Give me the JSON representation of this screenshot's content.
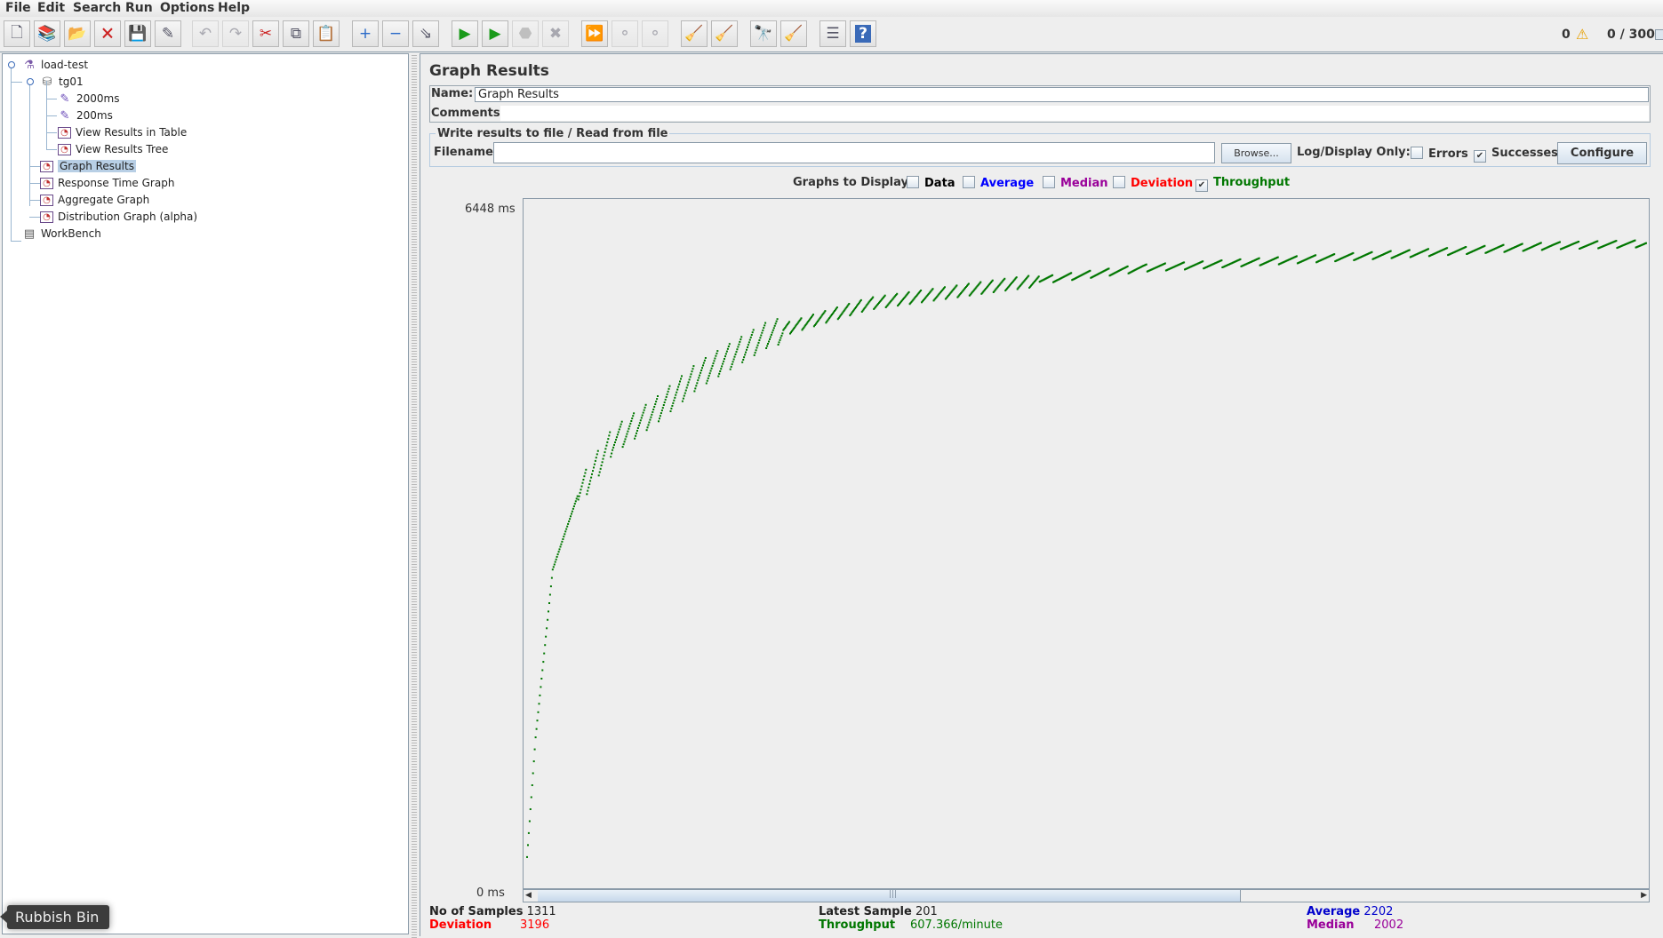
{
  "menu": [
    {
      "label": "File",
      "mnemonic": "F"
    },
    {
      "label": "Edit",
      "mnemonic": "E"
    },
    {
      "label": "Search",
      "mnemonic": ""
    },
    {
      "label": "Run",
      "mnemonic": "R"
    },
    {
      "label": "Options",
      "mnemonic": "O"
    },
    {
      "label": "Help",
      "mnemonic": "H"
    }
  ],
  "toolbar": {
    "buttons": [
      {
        "name": "new-icon",
        "glyph": "🗋",
        "enabled": true
      },
      {
        "name": "templates-icon",
        "glyph": "📚",
        "enabled": true
      },
      {
        "name": "open-icon",
        "glyph": "📂",
        "enabled": true
      },
      {
        "name": "close-icon",
        "glyph": "🗙",
        "enabled": true
      },
      {
        "name": "save-icon",
        "glyph": "💾",
        "enabled": true
      },
      {
        "name": "save-as-icon",
        "glyph": "✎",
        "enabled": true
      },
      {
        "name": "undo-icon",
        "glyph": "↶",
        "enabled": false
      },
      {
        "name": "redo-icon",
        "glyph": "↷",
        "enabled": false
      },
      {
        "name": "cut-icon",
        "glyph": "✂",
        "enabled": true
      },
      {
        "name": "copy-icon",
        "glyph": "⧉",
        "enabled": true
      },
      {
        "name": "paste-icon",
        "glyph": "📋",
        "enabled": true
      },
      {
        "name": "expand-icon",
        "glyph": "+",
        "enabled": true
      },
      {
        "name": "collapse-icon",
        "glyph": "−",
        "enabled": true
      },
      {
        "name": "toggle-icon",
        "glyph": "⇘",
        "enabled": true
      },
      {
        "name": "start-icon",
        "glyph": "▶",
        "enabled": true
      },
      {
        "name": "start-no-pauses-icon",
        "glyph": "▶",
        "enabled": true
      },
      {
        "name": "stop-icon",
        "glyph": "⬣",
        "enabled": false
      },
      {
        "name": "shutdown-icon",
        "glyph": "✖",
        "enabled": false
      },
      {
        "name": "remote-start-icon",
        "glyph": "⏩",
        "enabled": true
      },
      {
        "name": "remote-stop-icon",
        "glyph": "⚬",
        "enabled": false
      },
      {
        "name": "remote-shutdown-icon",
        "glyph": "⚬",
        "enabled": false
      },
      {
        "name": "clear-icon",
        "glyph": "🧹",
        "enabled": true
      },
      {
        "name": "clear-all-icon",
        "glyph": "🧹",
        "enabled": true
      },
      {
        "name": "search-icon",
        "glyph": "🔭",
        "enabled": true
      },
      {
        "name": "reset-search-icon",
        "glyph": "🧹",
        "enabled": true
      },
      {
        "name": "function-helper-icon",
        "glyph": "☰",
        "enabled": true
      },
      {
        "name": "help-icon",
        "glyph": "?",
        "enabled": true
      }
    ],
    "error_count": "0",
    "threads": "0 / 300"
  },
  "tree": [
    {
      "label": "load-test",
      "icon": "flask-icon",
      "level": 0
    },
    {
      "label": "tg01",
      "icon": "thread-group-icon",
      "level": 1
    },
    {
      "label": "2000ms",
      "icon": "sampler-icon",
      "level": 2
    },
    {
      "label": "200ms",
      "icon": "sampler-icon",
      "level": 2
    },
    {
      "label": "View Results in Table",
      "icon": "listener-icon",
      "level": 2
    },
    {
      "label": "View Results Tree",
      "icon": "listener-icon",
      "level": 2
    },
    {
      "label": "Graph Results",
      "icon": "listener-icon",
      "level": 1,
      "selected": true
    },
    {
      "label": "Response Time Graph",
      "icon": "listener-icon",
      "level": 1
    },
    {
      "label": "Aggregate Graph",
      "icon": "listener-icon",
      "level": 1
    },
    {
      "label": "Distribution Graph (alpha)",
      "icon": "listener-icon",
      "level": 1
    },
    {
      "label": "WorkBench",
      "icon": "workbench-icon",
      "level": 0
    }
  ],
  "tooltip": "Rubbish Bin",
  "panel": {
    "title": "Graph Results",
    "name_label": "Name:",
    "name_value": "Graph Results",
    "comments_label": "Comments:",
    "comments_value": "",
    "file_group_title": "Write results to file / Read from file",
    "filename_label": "Filename",
    "filename_value": "",
    "browse_label": "Browse...",
    "log_display_label": "Log/Display Only:",
    "errors_label": "Errors",
    "errors_checked": false,
    "successes_label": "Successes",
    "successes_checked": true,
    "configure_label": "Configure",
    "graphs_to_display_label": "Graphs to Display",
    "graph_options": [
      {
        "label": "Data",
        "checked": false,
        "color": "#000000"
      },
      {
        "label": "Average",
        "checked": false,
        "color": "#0000ff"
      },
      {
        "label": "Median",
        "checked": false,
        "color": "#990099"
      },
      {
        "label": "Deviation",
        "checked": false,
        "color": "#ff0000"
      },
      {
        "label": "Throughput",
        "checked": true,
        "color": "#007700"
      }
    ]
  },
  "stats": {
    "samples_label": "No of Samples",
    "samples_value": "1311",
    "deviation_label": "Deviation",
    "deviation_value": "3196",
    "latest_label": "Latest Sample",
    "latest_value": "201",
    "throughput_label": "Throughput",
    "throughput_value": "607.366/minute",
    "average_label": "Average",
    "average_value": "2202",
    "median_label": "Median",
    "median_value": "2002",
    "colors": {
      "deviation": "#ff0000",
      "throughput": "#007700",
      "average": "#0000cc",
      "median": "#990099"
    }
  },
  "chart_data": {
    "type": "scatter",
    "title": "",
    "ylabel_top": "6448 ms",
    "ylabel_bottom": "0 ms",
    "ylim": [
      0,
      6448
    ],
    "xlim": [
      0,
      1311
    ],
    "series": [
      {
        "name": "Throughput",
        "color": "#007700",
        "anchors_x": [
          0,
          10,
          30,
          60,
          100,
          150,
          200,
          280,
          400,
          560,
          720,
          880,
          1040,
          1200,
          1311
        ],
        "anchors_y": [
          300,
          1420,
          2990,
          3700,
          4200,
          4480,
          4815,
          5190,
          5480,
          5660,
          5810,
          5880,
          5950,
          6020,
          6040
        ]
      }
    ]
  }
}
